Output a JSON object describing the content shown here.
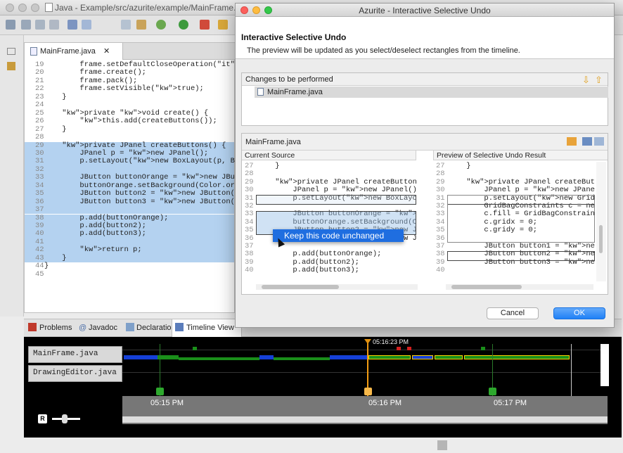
{
  "window": {
    "title": "Java - Example/src/azurite/example/MainFrame.java - Eclipse - /Users/yyllstein/Programming/EclipseWorkspace-4.4-AzuriteScreenshot"
  },
  "editor": {
    "tab_label": "MainFrame.java",
    "lines": [
      {
        "n": "19",
        "code": "        frame.setDefaultCloseOperation(EXIT_",
        "sel": false
      },
      {
        "n": "20",
        "code": "        frame.create();",
        "sel": false
      },
      {
        "n": "21",
        "code": "        frame.pack();",
        "sel": false
      },
      {
        "n": "22",
        "code": "        frame.setVisible(true);",
        "sel": false
      },
      {
        "n": "23",
        "code": "    }",
        "sel": false
      },
      {
        "n": "24",
        "code": "",
        "sel": false
      },
      {
        "n": "25",
        "code": "    private void create() {",
        "sel": false
      },
      {
        "n": "26",
        "code": "        this.add(createButtons());",
        "sel": false
      },
      {
        "n": "27",
        "code": "    }",
        "sel": false
      },
      {
        "n": "28",
        "code": "",
        "sel": false
      },
      {
        "n": "29",
        "code": "    private JPanel createButtons() {",
        "sel": true
      },
      {
        "n": "30",
        "code": "        JPanel p = new JPanel();",
        "sel": true
      },
      {
        "n": "31",
        "code": "        p.setLayout(new BoxLayout(p, BoxLayo",
        "sel": true
      },
      {
        "n": "32",
        "code": "",
        "sel": true
      },
      {
        "n": "33",
        "code": "        JButton buttonOrange = new JButton(\"",
        "sel": true
      },
      {
        "n": "34",
        "code": "        buttonOrange.setBackground(Color.ora",
        "sel": true
      },
      {
        "n": "35",
        "code": "        JButton button2 = new JButton(\"Butt",
        "sel": true
      },
      {
        "n": "36",
        "code": "        JButton button3 = new JButton(\"Butt",
        "sel": true
      },
      {
        "n": "37",
        "code": "",
        "sel": true
      },
      {
        "n": "38",
        "code": "        p.add(buttonOrange);",
        "sel": true
      },
      {
        "n": "39",
        "code": "        p.add(button2);",
        "sel": true
      },
      {
        "n": "40",
        "code": "        p.add(button3);",
        "sel": true
      },
      {
        "n": "41",
        "code": "",
        "sel": true
      },
      {
        "n": "42",
        "code": "        return p;",
        "sel": true
      },
      {
        "n": "43",
        "code": "    }",
        "sel": true
      },
      {
        "n": "44",
        "code": "}",
        "sel": false
      },
      {
        "n": "45",
        "code": "",
        "sel": false
      }
    ]
  },
  "bottom_tabs": [
    "Problems",
    "Javadoc",
    "Declaration",
    "Timeline View"
  ],
  "timeline": {
    "rows": [
      "MainFrame.java",
      "DrawingEditor.java"
    ],
    "cursor_time": "05:16:23 PM",
    "ticks": [
      "05:15 PM",
      "05:16 PM",
      "05:17 PM"
    ],
    "r_label": "R"
  },
  "dialog": {
    "title": "Azurite - Interactive Selective Undo",
    "heading": "Interactive Selective Undo",
    "description": "The preview will be updated as you select/deselect rectangles from the timeline.",
    "changes_label": "Changes to be performed",
    "changes_item": "MainFrame.java",
    "compare_file": "MainFrame.java",
    "left_header": "Current Source",
    "right_header": "Preview of Selective Undo Result",
    "left_lines": [
      {
        "n": "27",
        "code": "    }"
      },
      {
        "n": "28",
        "code": ""
      },
      {
        "n": "29",
        "code": "    private JPanel createButtons() {"
      },
      {
        "n": "30",
        "code": "        JPanel p = new JPanel();"
      },
      {
        "n": "31",
        "code": "        p.setLayout(new BoxLayout(p,"
      },
      {
        "n": "32",
        "code": ""
      },
      {
        "n": "33",
        "code": "        JButton buttonOrange = new JB"
      },
      {
        "n": "34",
        "code": "        buttonOrange.setBackground(Co"
      },
      {
        "n": "35",
        "code": "        JButton button2 = new JButton"
      },
      {
        "n": "36",
        "code": "        JButton button3 = new JButton"
      },
      {
        "n": "37",
        "code": ""
      },
      {
        "n": "38",
        "code": "        p.add(buttonOrange);"
      },
      {
        "n": "39",
        "code": "        p.add(button2);"
      },
      {
        "n": "40",
        "code": "        p.add(button3);"
      }
    ],
    "right_lines": [
      {
        "n": "27",
        "code": "    }"
      },
      {
        "n": "28",
        "code": ""
      },
      {
        "n": "29",
        "code": "    private JPanel createButtons("
      },
      {
        "n": "30",
        "code": "        JPanel p = new JPanel();"
      },
      {
        "n": "31",
        "code": "        p.setLayout(new GridBagLa"
      },
      {
        "n": "32",
        "code": "        GridBagConstraints c = ne"
      },
      {
        "n": "33",
        "code": "        c.fill = GridBagConstrain"
      },
      {
        "n": "34",
        "code": "        c.gridx = 0;"
      },
      {
        "n": "35",
        "code": "        c.gridy = 0;"
      },
      {
        "n": "36",
        "code": ""
      },
      {
        "n": "37",
        "code": "        JButton button1 = new JBu"
      },
      {
        "n": "38",
        "code": "        JButton button2 = new JBu"
      },
      {
        "n": "39",
        "code": "        JButton button3 = new JBu"
      },
      {
        "n": "40",
        "code": ""
      }
    ],
    "context_menu": "Keep this code unchanged",
    "cancel_label": "Cancel",
    "ok_label": "OK"
  }
}
